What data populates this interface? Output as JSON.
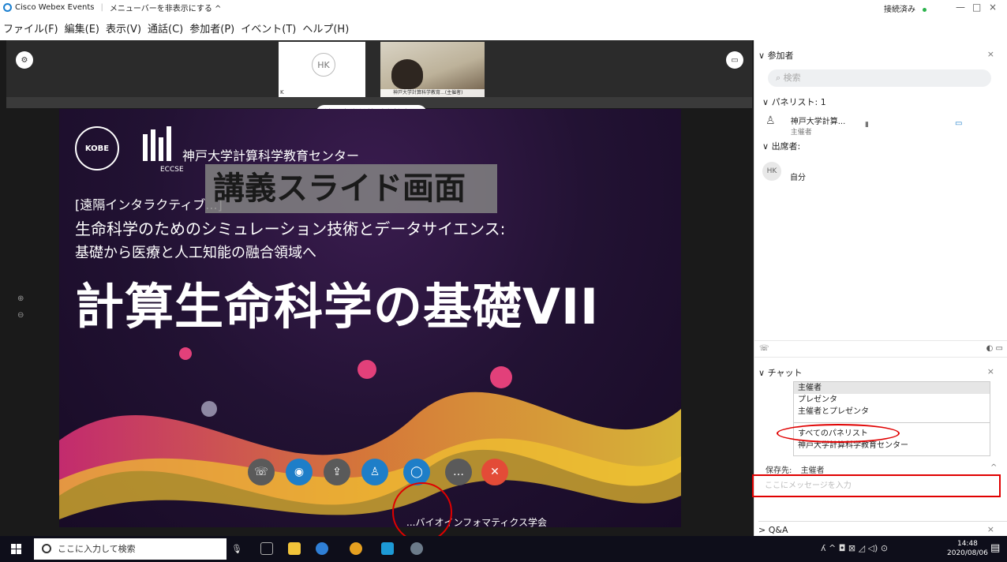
{
  "window": {
    "app_title": "Cisco Webex Events",
    "menu_toggle": "メニューバーを非表示にする ^",
    "connection_status": "接続済み",
    "minimize": "—",
    "restore": "□",
    "close": "×"
  },
  "menubar": {
    "items": [
      "ファイル(F)",
      "編集(E)",
      "表示(V)",
      "通話(C)",
      "参加者(P)",
      "イベント(T)",
      "ヘルプ(H)"
    ]
  },
  "meeting": {
    "hk_initials": "HK",
    "hk_name": "K",
    "cam_label": "神戸大学計算科学教育...(主催者)",
    "presenter_pill": "神戸大学計算科学教育..."
  },
  "slide": {
    "logo_text": "KOBE",
    "eccse": "ECCSE",
    "org_name": "神戸大学計算科学教育センター",
    "overlay_caption": "講義スライド画面",
    "subtitle1": "[遠隔インタラクティブ...]",
    "subtitle2": "生命科学のためのシミュレーション技術とデータサイエンス:",
    "subtitle3": "基礎から医療と人工知能の融合領域へ",
    "main_title": "計算生命科学の基礎VII",
    "bottom_text": "...バイオインフォマティクス学会"
  },
  "panel": {
    "participants_title": "参加者",
    "search_placeholder": "検索",
    "panelists_section": "パネリスト: 1",
    "panelist_name": "神戸大学計算...",
    "panelist_role": "主催者",
    "attendees_section": "出席者:",
    "attendee_initials": "HK",
    "attendee_name": "自分",
    "chat_title": "チャット",
    "chat_options": [
      "主催者",
      "プレゼンタ",
      "主催者とプレゼンタ"
    ],
    "chat_options2": [
      "すべてのパネリスト",
      "神戸大学計算科学教育センター"
    ],
    "send_to_label": "保存先:",
    "send_to_value": "主催者",
    "chat_input_placeholder": "ここにメッセージを入力",
    "qa_title": "Q&A"
  },
  "taskbar": {
    "search_placeholder": "ここに入力して検索",
    "time": "14:48",
    "date": "2020/08/06"
  }
}
